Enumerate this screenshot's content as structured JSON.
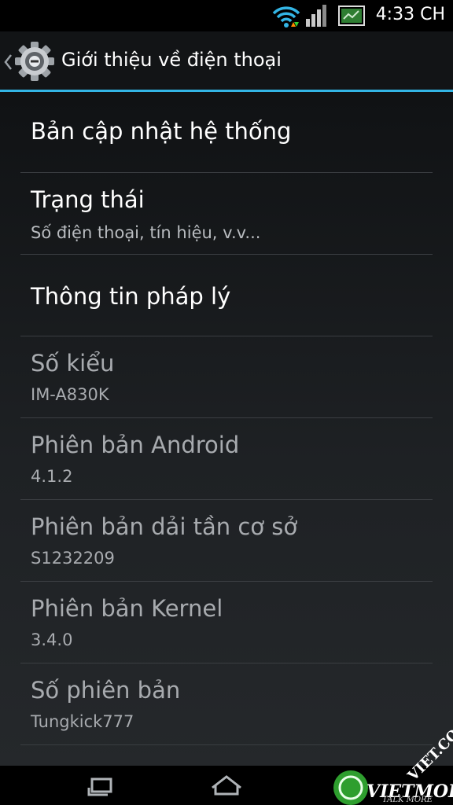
{
  "status_bar": {
    "time": "4:33 CH",
    "icons": [
      "wifi-icon",
      "signal-icon",
      "battery-icon"
    ]
  },
  "action_bar": {
    "title": "Giới thiệu về điện thoại",
    "icon": "settings-gear-icon",
    "back_icon": "chevron-left-icon"
  },
  "items": [
    {
      "title": "Bản cập nhật hệ thống"
    },
    {
      "title": "Trạng thái",
      "subtitle": "Số điện thoại, tín hiệu, v.v..."
    },
    {
      "title": "Thông tin pháp lý"
    },
    {
      "title": "Số kiểu",
      "subtitle": "IM-A830K"
    },
    {
      "title": "Phiên bản Android",
      "subtitle": "4.1.2"
    },
    {
      "title": "Phiên bản dải tần cơ sở",
      "subtitle": "S1232209"
    },
    {
      "title": "Phiên bản Kernel",
      "subtitle": "3.4.0"
    },
    {
      "title": "Số phiên bản",
      "subtitle": "Tungkick777"
    }
  ],
  "nav_bar": {
    "buttons": [
      "recent-apps-icon",
      "home-icon"
    ]
  },
  "watermark": {
    "line1": "VIETMOBILE",
    "line2": "VIET.COM",
    "tagline": "TALK MORE"
  }
}
